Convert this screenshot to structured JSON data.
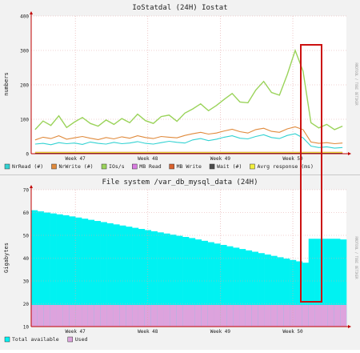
{
  "colors": {
    "background": "#f2f2f2",
    "plot_bg": "#ffffff",
    "grid": "#e3a3a3",
    "axis": "#c00000",
    "red_box": "#cc1111",
    "nrread": "#32d2d2",
    "nrwrite": "#e08a3c",
    "ios": "#9ad35a",
    "mbread": "#d87be0",
    "mbwrite": "#d9602c",
    "wait": "#4c4c4c",
    "avrg": "#f2ef3c",
    "total_available": "#00f2f2",
    "used": "#dda3dd"
  },
  "chart_data": [
    {
      "type": "line",
      "title": "IoStatdal (24H) Iostat",
      "side_label": "RRDTOOL / TOBI OETIKER",
      "ylabel": "numbers",
      "ylim": [
        0,
        400
      ],
      "yticks": [
        0,
        100,
        200,
        300,
        400
      ],
      "xticks": [
        "Week 47",
        "Week 48",
        "Week 49",
        "Week 50"
      ],
      "xtick_positions": [
        0.14,
        0.37,
        0.6,
        0.83
      ],
      "legend_position": "bottom",
      "series": [
        {
          "name": "NrRead (#)",
          "key": "nrread",
          "values": [
            28,
            30,
            26,
            32,
            29,
            31,
            27,
            34,
            30,
            28,
            33,
            29,
            31,
            35,
            30,
            28,
            32,
            36,
            33,
            31,
            40,
            44,
            38,
            42,
            48,
            52,
            45,
            43,
            50,
            55,
            47,
            44,
            53,
            58,
            46,
            22,
            18,
            20,
            16,
            18
          ]
        },
        {
          "name": "NrWrite (#)",
          "key": "nrwrite",
          "values": [
            40,
            48,
            44,
            52,
            42,
            46,
            50,
            45,
            41,
            47,
            43,
            49,
            45,
            52,
            47,
            44,
            50,
            48,
            46,
            53,
            58,
            62,
            57,
            60,
            66,
            71,
            64,
            60,
            70,
            74,
            65,
            62,
            72,
            78,
            70,
            34,
            30,
            32,
            29,
            31
          ]
        },
        {
          "name": "IOs/s",
          "key": "ios",
          "values": [
            70,
            95,
            82,
            110,
            76,
            92,
            105,
            88,
            80,
            98,
            85,
            102,
            90,
            115,
            96,
            88,
            108,
            112,
            94,
            118,
            130,
            145,
            125,
            140,
            158,
            175,
            150,
            148,
            185,
            210,
            178,
            170,
            230,
            300,
            240,
            90,
            75,
            85,
            70,
            80
          ]
        },
        {
          "name": "MB Read",
          "key": "mbread",
          "values": [
            2,
            2,
            2,
            2,
            2,
            2,
            2,
            2,
            2,
            2,
            2,
            2,
            2,
            2,
            2,
            2,
            2,
            2,
            2,
            2,
            2,
            2,
            2,
            2,
            2,
            2,
            2,
            2,
            2,
            2,
            2,
            2,
            2,
            2,
            2,
            2,
            2,
            2,
            2,
            2
          ]
        },
        {
          "name": "MB Write",
          "key": "mbwrite",
          "values": [
            4,
            4,
            4,
            4,
            4,
            4,
            4,
            4,
            4,
            4,
            4,
            4,
            4,
            4,
            4,
            4,
            4,
            4,
            4,
            4,
            4,
            4,
            4,
            4,
            4,
            4,
            4,
            4,
            4,
            4,
            4,
            4,
            4,
            4,
            4,
            4,
            4,
            4,
            4,
            4
          ]
        },
        {
          "name": "Wait (#)",
          "key": "wait",
          "values": [
            1,
            1,
            1,
            1,
            1,
            1,
            1,
            1,
            1,
            1,
            1,
            1,
            1,
            1,
            1,
            1,
            1,
            1,
            1,
            1,
            1,
            1,
            1,
            1,
            1,
            1,
            1,
            1,
            1,
            1,
            1,
            1,
            1,
            1,
            1,
            1,
            1,
            1,
            1,
            1
          ]
        },
        {
          "name": "Avrg response (ms)",
          "key": "avrg",
          "values": [
            3,
            3,
            3,
            3,
            3,
            3,
            3,
            3,
            3,
            3,
            3,
            3,
            3,
            3,
            3,
            3,
            3,
            3,
            3,
            3,
            3,
            3,
            3,
            3,
            3,
            3,
            3,
            3,
            3,
            3,
            3,
            3,
            3,
            3,
            3,
            3,
            3,
            3,
            3,
            3
          ]
        }
      ]
    },
    {
      "type": "area",
      "title": "File system /var_db_mysql_data (24H)",
      "side_label": "RRDTOOL / TOBI OETIKER",
      "ylabel": "Gigabytes",
      "ylim": [
        10,
        70
      ],
      "yticks": [
        10,
        20,
        30,
        40,
        50,
        60,
        70
      ],
      "xticks": [
        "Week 47",
        "Week 48",
        "Week 49",
        "Week 50"
      ],
      "xtick_positions": [
        0.14,
        0.37,
        0.6,
        0.83
      ],
      "legend_position": "bottom",
      "series": [
        {
          "name": "Total available",
          "key": "total_available",
          "values": [
            61,
            60.5,
            60,
            59.6,
            59.2,
            58.8,
            58.3,
            57.8,
            57.3,
            56.8,
            56.3,
            55.8,
            55.3,
            54.8,
            54.3,
            53.8,
            53.3,
            52.8,
            52.3,
            51.8,
            51.3,
            50.8,
            50.3,
            49.8,
            49.3,
            48.8,
            48.2,
            47.6,
            47,
            46.4,
            45.8,
            45.2,
            44.6,
            44,
            43.4,
            42.8,
            42.2,
            41.6,
            41,
            40.4,
            39.8,
            39.2,
            38.6,
            38,
            48.5,
            48.5,
            48.5,
            48.5,
            48.5,
            48.2
          ]
        },
        {
          "name": "Used",
          "key": "used",
          "values": [
            19.5,
            19.5,
            19.5,
            19.5,
            19.5,
            19.5,
            19.5,
            19.5,
            19.5,
            19.5,
            19.5,
            19.5,
            19.5,
            19.5,
            19.5,
            19.5,
            19.5,
            19.5,
            19.5,
            19.5,
            19.5,
            19.5,
            19.5,
            19.5,
            19.5,
            19.5,
            19.5,
            19.5,
            19.5,
            19.5,
            19.5,
            19.5,
            19.5,
            19.5,
            19.5,
            19.5,
            19.5,
            19.5,
            19.5,
            19.5,
            19.5,
            19.5,
            19.5,
            19.5,
            19.5,
            19.5,
            19.5,
            19.5,
            19.5,
            19.5
          ]
        }
      ]
    }
  ]
}
